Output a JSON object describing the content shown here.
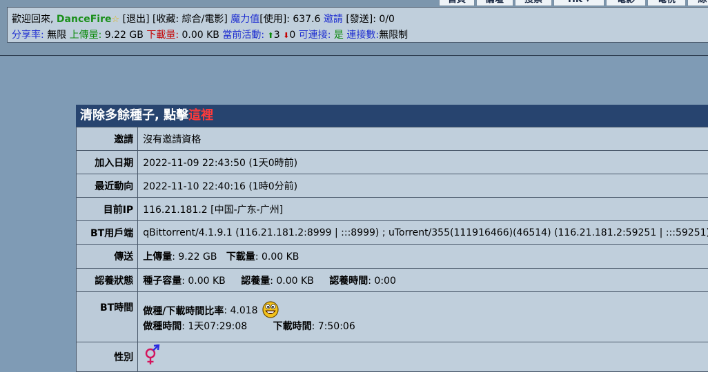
{
  "nav": {
    "tabs": [
      "首頁",
      "論壇",
      "搜索",
      "HK ▾",
      "電影",
      "電視",
      "綜合 ▾"
    ]
  },
  "status": {
    "welcome": "歡迎回來,",
    "username": "DanceFire",
    "logout": "[退出]",
    "favorites": "[收藏: 綜合/電影]",
    "bonus_label": "魔力值",
    "bonus_value": "[使用]: 637.6",
    "invite_label": "邀請",
    "invite_value": "[發送]: 0/0",
    "ratio_label": "分享率:",
    "ratio_value": "無限",
    "uploaded_label": "上傳量:",
    "uploaded_value": "9.22 GB",
    "downloaded_label": "下載量:",
    "downloaded_value": "0.00 KB",
    "active_label": "當前活動:",
    "active_seeding": "3",
    "active_leeching": "0",
    "connectable_label": "可連接:",
    "connectable_value": "是",
    "connections_label": "連接數:",
    "connections_value": "無限制"
  },
  "panel": {
    "title_prefix": "清除多餘種子, 點擊",
    "title_link": "這裡",
    "rows": {
      "invite": {
        "label": "邀請",
        "value": "沒有邀請資格"
      },
      "joined": {
        "label": "加入日期",
        "value": "2022-11-09 22:43:50 (1天0時前)"
      },
      "last_action": {
        "label": "最近動向",
        "value": "2022-11-10 22:40:16 (1時0分前)"
      },
      "ip": {
        "label": "目前IP",
        "value": "116.21.181.2 [中国-广东-广州]"
      },
      "client": {
        "label": "BT用戶端",
        "value": "qBittorrent/4.1.9.1 (116.21.181.2:8999 | :::8999) ; uTorrent/355(111916466)(46514) (116.21.181.2:59251 | :::59251)"
      },
      "transfer": {
        "label": "傳送",
        "up_label": "上傳量",
        "up_value": ": 9.22 GB",
        "down_label": "下載量",
        "down_value": ": 0.00 KB"
      },
      "seeding_status": {
        "label": "認養狀態",
        "size_label": "種子容量",
        "size_value": ":  0.00 KB",
        "adopted_label": "認養量",
        "adopted_value": ":  0.00 KB",
        "time_label": "認養時間",
        "time_value": ":  0:00"
      },
      "bt_time": {
        "label": "BT時間",
        "ratio_label": "做種/下載時間比率",
        "ratio_value": ": 4.018",
        "seed_label": "做種時間",
        "seed_value": ": 1天07:29:08",
        "leech_label": "下載時間",
        "leech_value": ": 7:50:06"
      },
      "gender": {
        "label": "性別"
      }
    }
  },
  "icons": {
    "star": "star-icon",
    "up": "up-arrow-icon",
    "down": "down-arrow-icon",
    "face": "laughing-face-icon",
    "gender": "gender-symbol-icon"
  }
}
